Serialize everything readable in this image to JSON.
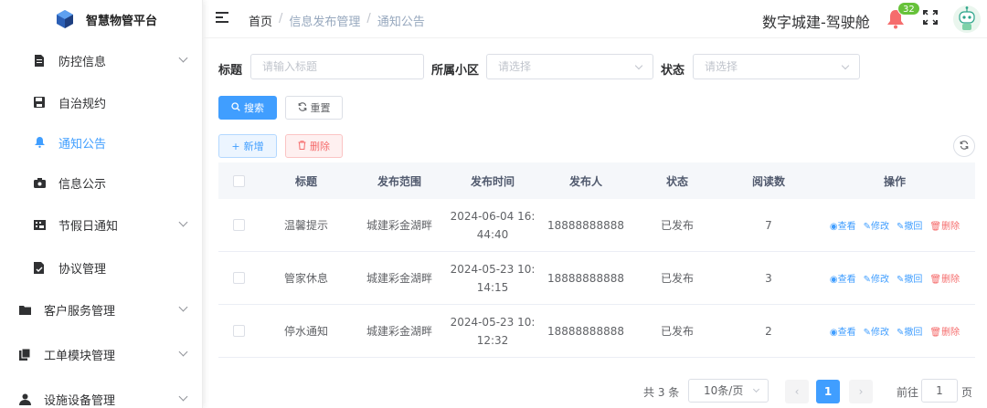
{
  "app": {
    "title": "智慧物管平台"
  },
  "header": {
    "breadcrumb": [
      "首页",
      "信息发布管理",
      "通知公告"
    ],
    "title": "数字城建-驾驶舱",
    "notification_count": "32"
  },
  "sidebar": {
    "items": [
      {
        "label": "防控信息",
        "icon": "document-icon",
        "expandable": true
      },
      {
        "label": "自治规约",
        "icon": "save-icon",
        "expandable": false
      },
      {
        "label": "通知公告",
        "icon": "bell-icon",
        "expandable": false,
        "active": true
      },
      {
        "label": "信息公示",
        "icon": "camera-icon",
        "expandable": false
      },
      {
        "label": "节假日通知",
        "icon": "ticket-icon",
        "expandable": true
      },
      {
        "label": "协议管理",
        "icon": "document-check-icon",
        "expandable": false
      },
      {
        "label": "客户服务管理",
        "icon": "folder-icon",
        "expandable": true
      },
      {
        "label": "工单模块管理",
        "icon": "files-icon",
        "expandable": true
      },
      {
        "label": "设施设备管理",
        "icon": "user-icon",
        "expandable": true
      }
    ]
  },
  "search": {
    "title_label": "标题",
    "title_placeholder": "请输入标题",
    "community_label": "所属小区",
    "community_placeholder": "请选择",
    "status_label": "状态",
    "status_placeholder": "请选择",
    "search_button": "搜索",
    "reset_button": "重置"
  },
  "toolbar": {
    "add_button": "新增",
    "delete_button": "删除"
  },
  "table": {
    "headers": [
      "标题",
      "发布范围",
      "发布时间",
      "发布人",
      "状态",
      "阅读数",
      "操作"
    ],
    "rows": [
      {
        "title": "温馨提示",
        "scope": "城建彩金湖畔",
        "time_line1": "2024-06-04 16:",
        "time_line2": "44:40",
        "publisher": "18888888888",
        "status": "已发布",
        "reads": "7"
      },
      {
        "title": "管家休息",
        "scope": "城建彩金湖畔",
        "time_line1": "2024-05-23 10:",
        "time_line2": "14:15",
        "publisher": "18888888888",
        "status": "已发布",
        "reads": "3"
      },
      {
        "title": "停水通知",
        "scope": "城建彩金湖畔",
        "time_line1": "2024-05-23 10:",
        "time_line2": "12:32",
        "publisher": "18888888888",
        "status": "已发布",
        "reads": "2"
      }
    ],
    "ops": {
      "view": "查看",
      "edit": "修改",
      "withdraw": "撤回",
      "delete": "删除"
    }
  },
  "pagination": {
    "total": "共 3 条",
    "page_size": "10条/页",
    "current_page": "1",
    "goto_label": "前往",
    "goto_value": "1",
    "page_suffix": "页"
  },
  "colors": {
    "primary": "#409eff",
    "danger": "#f56c6c",
    "badge": "#67c23a"
  }
}
